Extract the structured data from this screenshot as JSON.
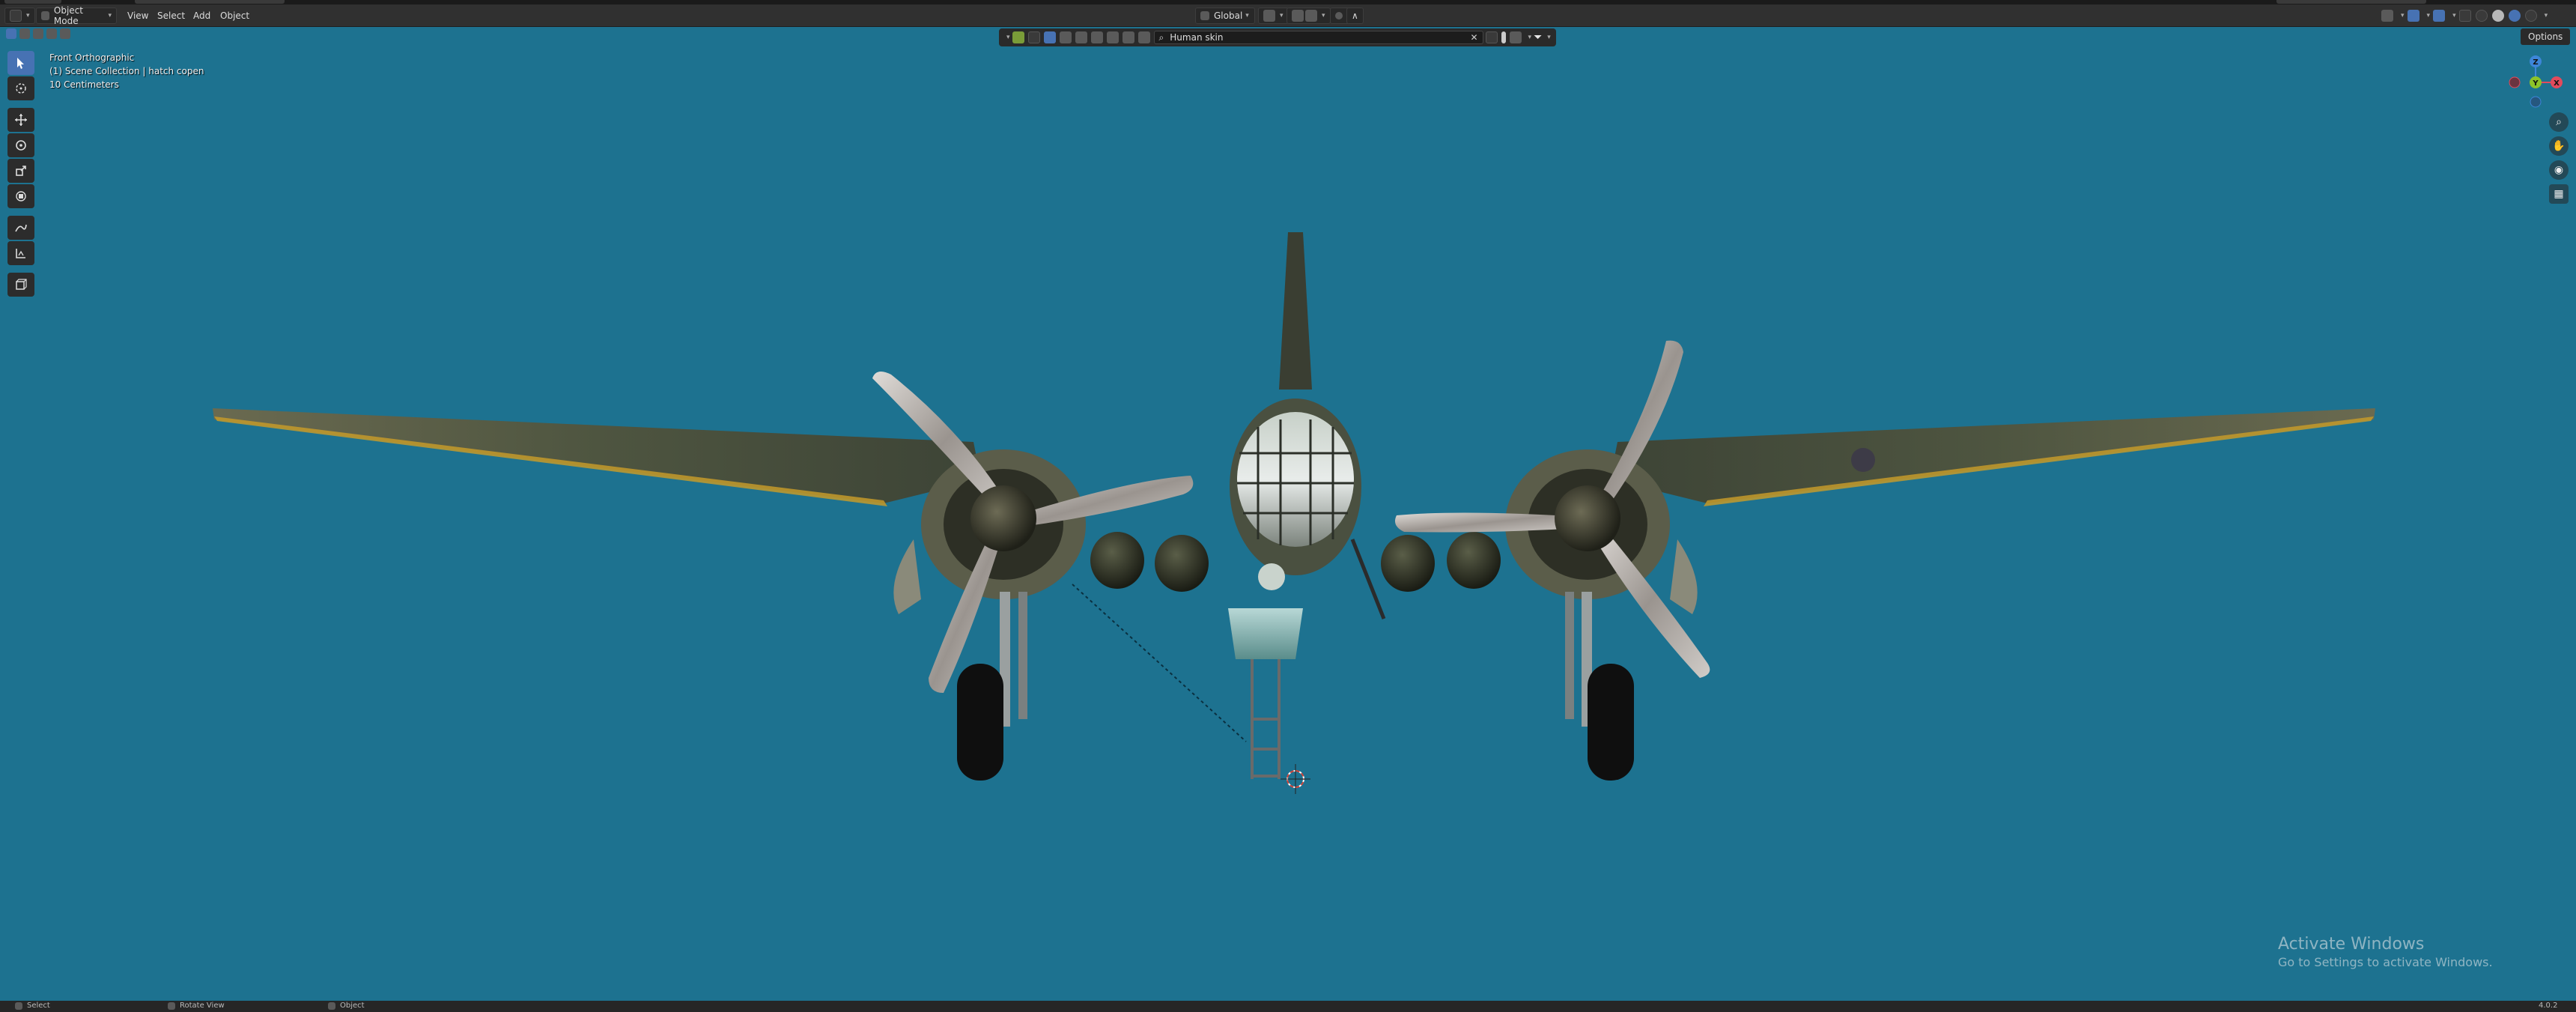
{
  "header": {
    "mode_label": "Object Mode",
    "menus": [
      "View",
      "Select",
      "Add",
      "Object"
    ],
    "transform_orientation": "Global",
    "options_label": "Options"
  },
  "viewport_header": {
    "search_value": "Human skin"
  },
  "viewport_info": {
    "view_name": "Front Orthographic",
    "collection": "(1) Scene Collection | hatch copen",
    "scale": "10 Centimeters"
  },
  "gizmo": {
    "z_label": "Z",
    "y_label": "Y",
    "x_label": "X",
    "colors": {
      "x": "#e34a5c",
      "y": "#8dc32a",
      "z": "#3d86d9"
    }
  },
  "toolbar": {
    "tools": [
      "tweak-icon",
      "cursor-icon",
      "move-icon",
      "rotate-icon",
      "scale-icon",
      "transform-icon",
      "annotate-icon",
      "measure-icon",
      "add-cube-icon"
    ]
  },
  "nav": {
    "buttons": [
      "zoom-icon",
      "hand-pan-icon",
      "camera-icon",
      "grid-icon"
    ]
  },
  "watermark": {
    "title": "Activate Windows",
    "subtitle": "Go to Settings to activate Windows."
  },
  "statusbar": {
    "select": "Select",
    "rotate": "Rotate View",
    "object": "Object",
    "version": "4.0.2"
  },
  "colors": {
    "viewport_bg": "#1d7290",
    "header_bg": "#303030",
    "accent": "#4772b3"
  }
}
